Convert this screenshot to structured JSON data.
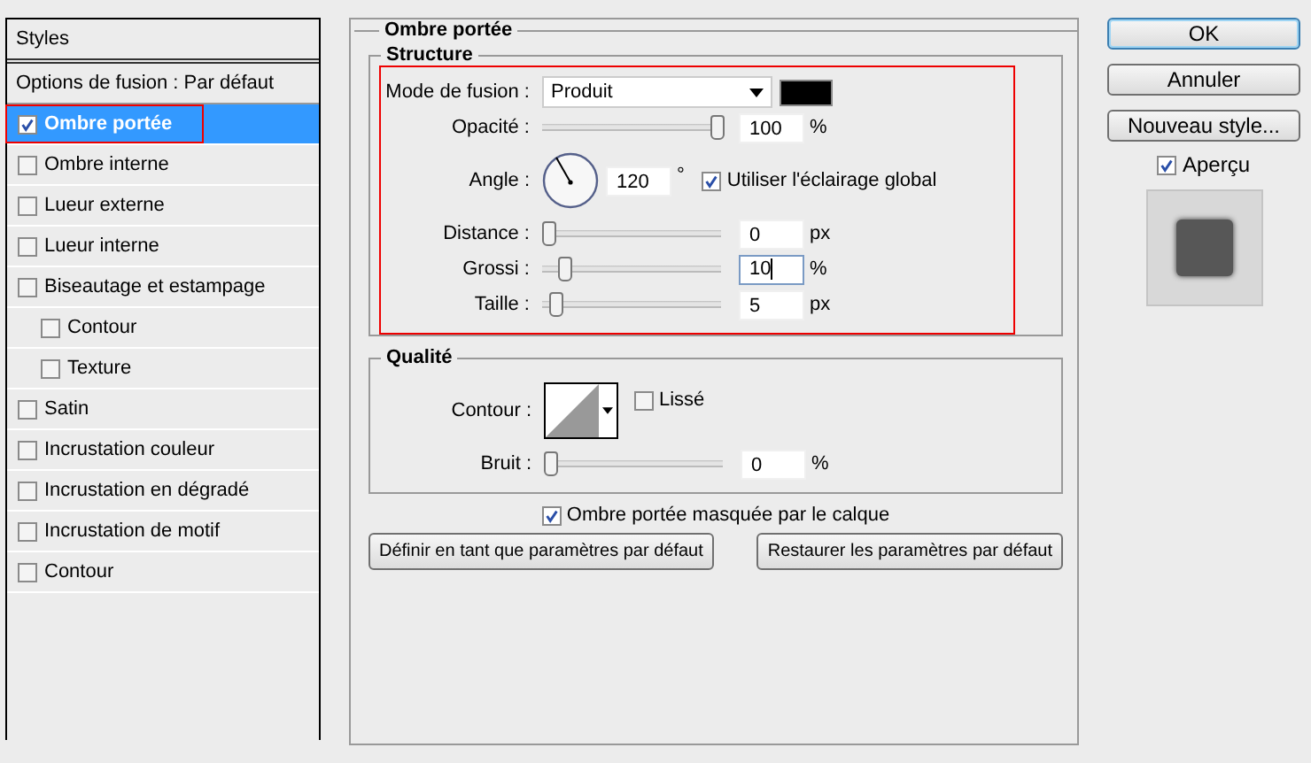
{
  "sidebar": {
    "title": "Styles",
    "options_row": "Options de fusion : Par défaut",
    "items": [
      {
        "label": "Ombre portée",
        "checked": true,
        "selected": true,
        "highlighted": true
      },
      {
        "label": "Ombre interne",
        "checked": false,
        "selected": false
      },
      {
        "label": "Lueur externe",
        "checked": false,
        "selected": false
      },
      {
        "label": "Lueur interne",
        "checked": false,
        "selected": false
      },
      {
        "label": "Biseautage et estampage",
        "checked": false,
        "selected": false,
        "children": [
          {
            "label": "Contour",
            "checked": false,
            "selected": false
          },
          {
            "label": "Texture",
            "checked": false,
            "selected": false
          }
        ]
      },
      {
        "label": "Satin",
        "checked": false,
        "selected": false
      },
      {
        "label": "Incrustation couleur",
        "checked": false,
        "selected": false
      },
      {
        "label": "Incrustation en dégradé",
        "checked": false,
        "selected": false
      },
      {
        "label": "Incrustation de motif",
        "checked": false,
        "selected": false
      },
      {
        "label": "Contour",
        "checked": false,
        "selected": false
      }
    ]
  },
  "panel": {
    "title": "Ombre portée",
    "structure": {
      "title": "Structure",
      "highlighted": true,
      "rows": [
        {
          "kind": "select",
          "label": "Mode de fusion :",
          "value": "Produit",
          "color": "#000000"
        },
        {
          "kind": "slider",
          "label": "Opacité :",
          "level": 1.0,
          "value": "100",
          "unit": "%"
        },
        {
          "kind": "angle",
          "label": "Angle :",
          "value": "120",
          "unit": "°",
          "checkbox": {
            "label": "Utiliser l'éclairage global",
            "checked": true
          }
        },
        {
          "kind": "slider",
          "label": "Distance :",
          "level": 0,
          "value": "0",
          "unit": "px"
        },
        {
          "kind": "slider",
          "label": "Grossi :",
          "level": 0.1,
          "value": "10",
          "unit": "%",
          "focused": true
        },
        {
          "kind": "slider",
          "label": "Taille :",
          "level": 0.04,
          "value": "5",
          "unit": "px"
        }
      ]
    },
    "quality": {
      "title": "Qualité",
      "rows": [
        {
          "kind": "contour",
          "label": "Contour :",
          "checkbox": {
            "label": "Lissé",
            "checked": false
          }
        },
        {
          "kind": "slider",
          "label": "Bruit :",
          "level": 0,
          "value": "0",
          "unit": "%"
        }
      ]
    },
    "masked": {
      "label": "Ombre portée masquée par le calque",
      "checked": true
    },
    "buttons": [
      "Définir en tant que paramètres par défaut",
      "Restaurer les paramètres par défaut"
    ]
  },
  "actions": [
    {
      "label": "OK",
      "default": true
    },
    {
      "label": "Annuler",
      "default": false
    },
    {
      "label": "Nouveau style...",
      "default": false
    }
  ],
  "preview": {
    "label": "Aperçu",
    "checked": true
  }
}
